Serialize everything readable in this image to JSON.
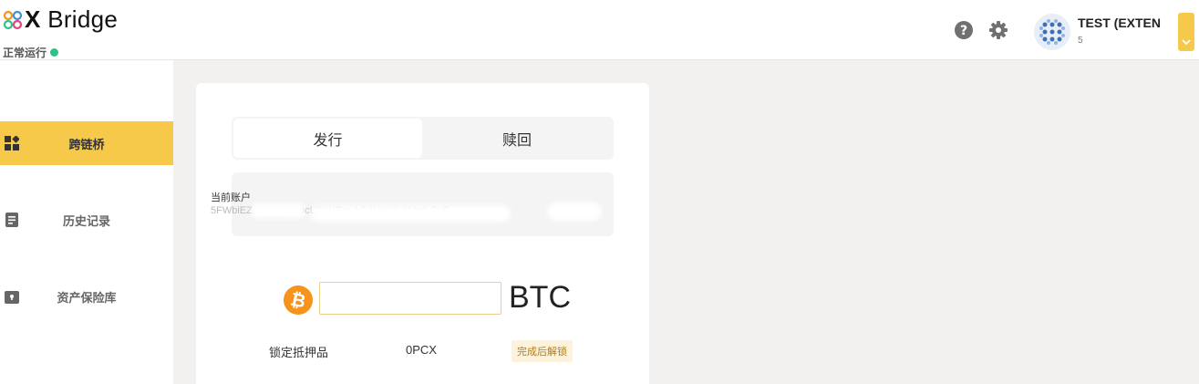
{
  "header": {
    "logo_text": "Bridge",
    "logo_mark": "X",
    "status_text": "正常运行",
    "status_color": "#2bc28a",
    "help_icon": "help-icon",
    "settings_icon": "gear-icon",
    "account": {
      "name": "TEST (EXTEN",
      "sub": "5"
    }
  },
  "sidebar": {
    "items": [
      {
        "label": "跨链桥",
        "icon": "dashboard-icon",
        "active": true
      },
      {
        "label": "历史记录",
        "icon": "document-icon",
        "active": false
      },
      {
        "label": "资产保险库",
        "icon": "vault-icon",
        "active": false
      }
    ]
  },
  "main": {
    "tabs": [
      {
        "label": "发行",
        "active": true
      },
      {
        "label": "赎回",
        "active": false
      }
    ],
    "current_account_label": "当前账户",
    "current_account_address": "5FWbiEZ...i9vRqwuocLi5xNTqpACdNaK2LkMo8jGpP",
    "amount_input_value": "",
    "amount_unit": "BTC",
    "collateral": {
      "label": "锁定抵押品",
      "value": "0PCX",
      "badge": "完成后解锁"
    }
  },
  "colors": {
    "accent": "#f6c94a",
    "btc": "#f7931a",
    "background": "#f2f1ef"
  }
}
